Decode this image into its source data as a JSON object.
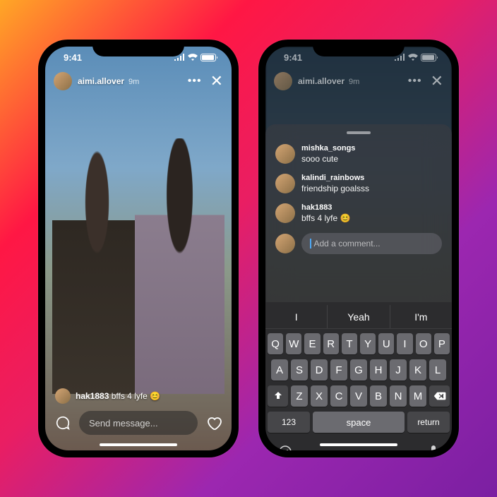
{
  "status": {
    "time": "9:41"
  },
  "story": {
    "username": "aimi.allover",
    "timeago": "9m",
    "featured_comment": {
      "user": "hak1883",
      "text": "bffs 4 lyfe 😊"
    },
    "message_placeholder": "Send message..."
  },
  "sheet": {
    "comments": [
      {
        "user": "mishka_songs",
        "text": "sooo cute"
      },
      {
        "user": "kalindi_rainbows",
        "text": "friendship goalsss"
      },
      {
        "user": "hak1883",
        "text": "bffs 4 lyfe 😊"
      }
    ],
    "add_placeholder": "Add a comment..."
  },
  "keyboard": {
    "suggestions": [
      "I",
      "Yeah",
      "I'm"
    ],
    "row1": [
      "Q",
      "W",
      "E",
      "R",
      "T",
      "Y",
      "U",
      "I",
      "O",
      "P"
    ],
    "row2": [
      "A",
      "S",
      "D",
      "F",
      "G",
      "H",
      "J",
      "K",
      "L"
    ],
    "row3": [
      "Z",
      "X",
      "C",
      "V",
      "B",
      "N",
      "M"
    ],
    "numkey": "123",
    "space": "space",
    "return": "return"
  }
}
